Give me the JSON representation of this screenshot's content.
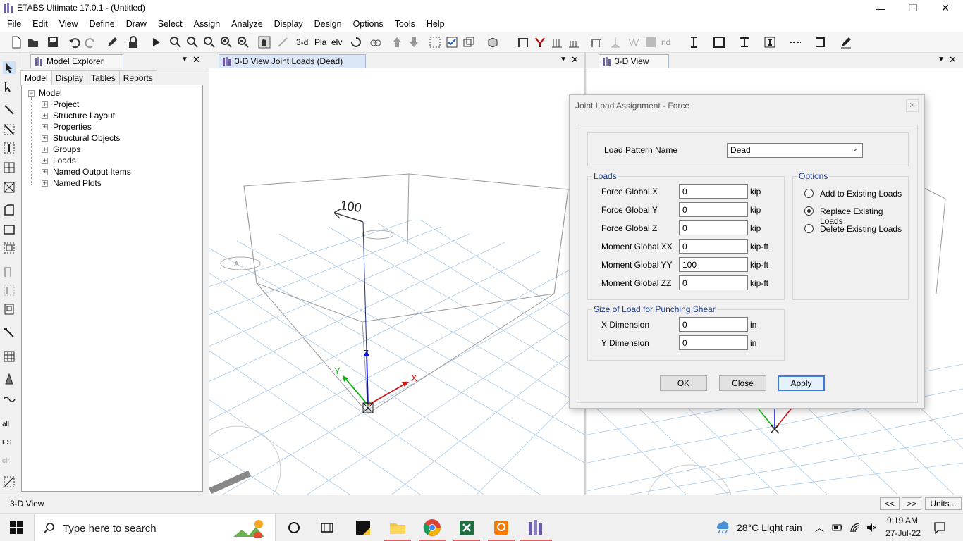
{
  "window": {
    "title": "ETABS Ultimate 17.0.1 - (Untitled)",
    "controls": {
      "minimize": "—",
      "restore": "❐",
      "close": "✕"
    }
  },
  "menu": [
    "File",
    "Edit",
    "View",
    "Define",
    "Draw",
    "Select",
    "Assign",
    "Analyze",
    "Display",
    "Design",
    "Options",
    "Tools",
    "Help"
  ],
  "toolbar": {
    "label_3d": "3-d",
    "label_pln": "Pla",
    "label_elv": "elv",
    "label_nd": "nd"
  },
  "leftstrip": {
    "all": "all",
    "ps": "PS",
    "clr": "clr"
  },
  "explorer": {
    "title": "Model Explorer",
    "tabs": [
      "Model",
      "Display",
      "Tables",
      "Reports"
    ],
    "root": "Model",
    "items": [
      "Project",
      "Structure Layout",
      "Properties",
      "Structural Objects",
      "Groups",
      "Loads",
      "Named Output Items",
      "Named Plots"
    ]
  },
  "view1": {
    "title": "3-D View  Joint Loads (Dead)",
    "load_label": "100",
    "axis_x": "X",
    "axis_y": "Y",
    "axis_z": "Z",
    "grid_label": "A"
  },
  "view2": {
    "title": "3-D View"
  },
  "dialog": {
    "title": "Joint Load Assignment - Force",
    "close": "✕",
    "load_pattern_label": "Load Pattern Name",
    "load_pattern_value": "Dead",
    "loads_group": "Loads",
    "fields": [
      {
        "label": "Force Global X",
        "value": "0",
        "unit": "kip"
      },
      {
        "label": "Force Global Y",
        "value": "0",
        "unit": "kip"
      },
      {
        "label": "Force Global Z",
        "value": "0",
        "unit": "kip"
      },
      {
        "label": "Moment Global XX",
        "value": "0",
        "unit": "kip-ft"
      },
      {
        "label": "Moment Global YY",
        "value": "100",
        "unit": "kip-ft"
      },
      {
        "label": "Moment Global ZZ",
        "value": "0",
        "unit": "kip-ft"
      }
    ],
    "options_group": "Options",
    "options": [
      {
        "label": "Add to Existing Loads",
        "selected": false
      },
      {
        "label": "Replace Existing Loads",
        "selected": true
      },
      {
        "label": "Delete Existing Loads",
        "selected": false
      }
    ],
    "punching_group": "Size of Load for Punching Shear",
    "punching": [
      {
        "label": "X Dimension",
        "value": "0",
        "unit": "in"
      },
      {
        "label": "Y Dimension",
        "value": "0",
        "unit": "in"
      }
    ],
    "buttons": {
      "ok": "OK",
      "close": "Close",
      "apply": "Apply"
    }
  },
  "status": {
    "text": "3-D View",
    "prev": "<<",
    "next": ">>",
    "units": "Units..."
  },
  "taskbar": {
    "search_placeholder": "Type here to search",
    "weather": "28°C  Light rain",
    "time": "9:19 AM",
    "date": "27-Jul-22"
  },
  "colors": {
    "accent": "#3b7ad9",
    "grid": "#9cc3e6",
    "group_label": "#1a3a8a"
  }
}
